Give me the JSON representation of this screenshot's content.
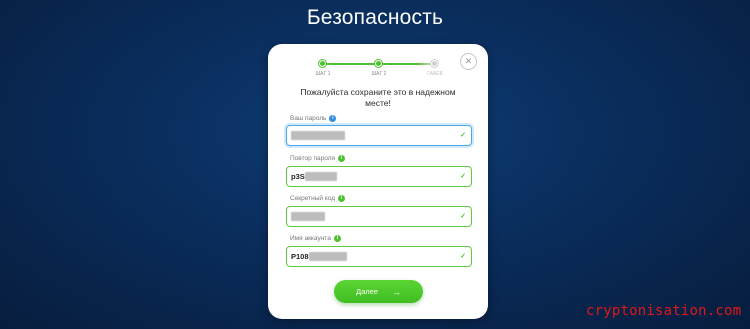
{
  "page": {
    "title": "Безопасность"
  },
  "stepper": {
    "steps": [
      {
        "label": "ШАГ 1",
        "state": "done"
      },
      {
        "label": "ШАГ 2",
        "state": "done"
      },
      {
        "label": "ГАБЕБ",
        "state": "pending"
      }
    ]
  },
  "dialog": {
    "note": "Пожалуйста сохраните это в надежном месте!",
    "close_icon": "close-icon",
    "fields": [
      {
        "label": "Ваш пароль",
        "value": "",
        "masked": true,
        "state": "focused",
        "info_color": "#2f8de0"
      },
      {
        "label": "Повтор пароля",
        "value": "p3S",
        "masked": true,
        "state": "valid",
        "info_color": "#4ec12f"
      },
      {
        "label": "Секретный код",
        "value": "",
        "masked": true,
        "state": "valid",
        "info_color": "#4ec12f"
      },
      {
        "label": "Имя аккаунта",
        "value": "P108",
        "masked": true,
        "state": "valid",
        "info_color": "#4ec12f"
      }
    ],
    "next_button": {
      "label": "Далее",
      "icon": "arrow-right-icon"
    }
  },
  "colors": {
    "accent_green": "#4ec12f",
    "focus_blue": "#49a9e6",
    "background": "#0a2d5c"
  },
  "watermark": "cryptonisation.com"
}
